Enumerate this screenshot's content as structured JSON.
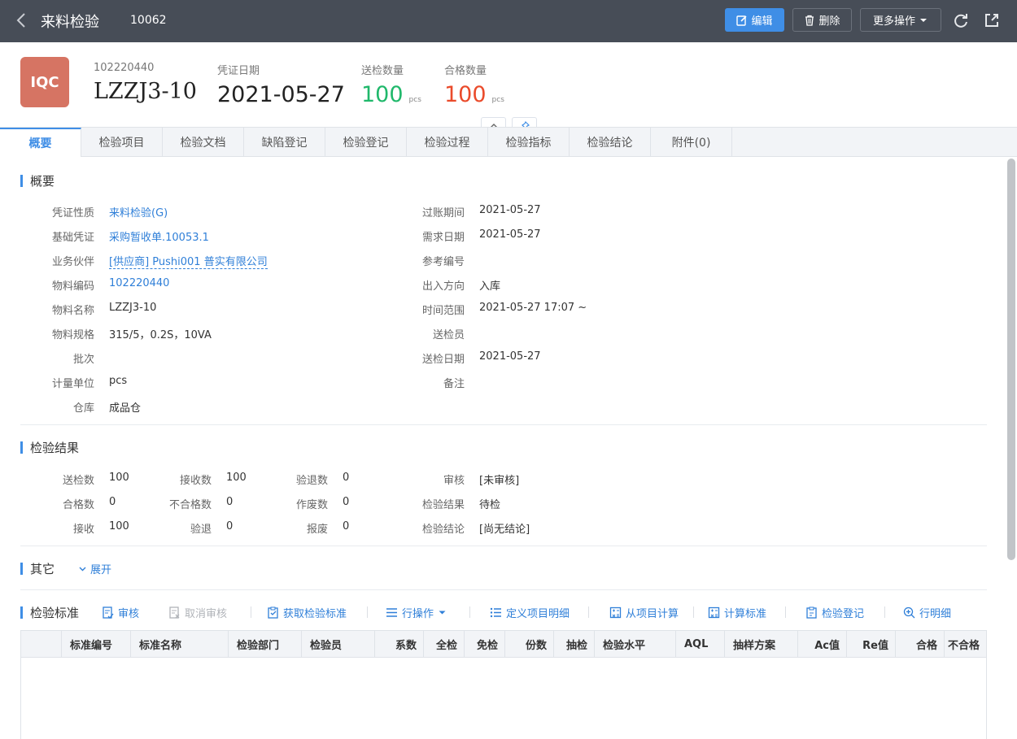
{
  "topbar": {
    "title": "来料检验",
    "doc_number": "10062",
    "edit_label": "编辑",
    "delete_label": "删除",
    "more_label": "更多操作",
    "bg_color": "#474d57",
    "accent_color": "#3f8ee6"
  },
  "header": {
    "avatar_text": "IQC",
    "avatar_color": "#d67463",
    "code_label": "102220440",
    "code_value": "LZZJ3-10",
    "date_label": "凭证日期",
    "date_value": "2021-05-27",
    "sent_qty_label": "送检数量",
    "sent_qty_value": "100",
    "sent_qty_unit": "pcs",
    "pass_qty_label": "合格数量",
    "pass_qty_value": "100",
    "pass_qty_unit": "pcs"
  },
  "tabs": [
    "概要",
    "检验项目",
    "检验文档",
    "缺陷登记",
    "检验登记",
    "检验过程",
    "检验指标",
    "检验结论",
    "附件(0)"
  ],
  "overview": {
    "title": "概要",
    "left": [
      {
        "label": "凭证性质",
        "value": "来料检验(G)"
      },
      {
        "label": "基础凭证",
        "value": "采购暂收单.10053.1"
      },
      {
        "label": "业务伙伴",
        "value": "[供应商] Pushi001 普实有限公司"
      },
      {
        "label": "物料编码",
        "value": "102220440"
      },
      {
        "label": "物料名称",
        "value": "LZZJ3-10"
      },
      {
        "label": "物料规格",
        "value": "315/5，0.2S，10VA"
      },
      {
        "label": "批次",
        "value": ""
      },
      {
        "label": "计量单位",
        "value": "pcs"
      },
      {
        "label": "仓库",
        "value": "成品仓"
      }
    ],
    "right": [
      {
        "label": "过账期间",
        "value": "2021-05-27"
      },
      {
        "label": "需求日期",
        "value": "2021-05-27"
      },
      {
        "label": "参考编号",
        "value": ""
      },
      {
        "label": "出入方向",
        "value": "入库"
      },
      {
        "label": "时间范围",
        "value": "2021-05-27 17:07 ~"
      },
      {
        "label": "送检员",
        "value": ""
      },
      {
        "label": "送检日期",
        "value": "2021-05-27"
      },
      {
        "label": "备注",
        "value": ""
      }
    ]
  },
  "result": {
    "title": "检验结果",
    "rows": [
      [
        {
          "label": "送检数",
          "value": "100"
        },
        {
          "label": "接收数",
          "value": "100"
        },
        {
          "label": "验退数",
          "value": "0"
        },
        {
          "label": "审核",
          "value": "[未审核]"
        }
      ],
      [
        {
          "label": "合格数",
          "value": "0"
        },
        {
          "label": "不合格数",
          "value": "0"
        },
        {
          "label": "作废数",
          "value": "0"
        },
        {
          "label": "检验结果",
          "value": "待检"
        }
      ],
      [
        {
          "label": "接收",
          "value": "100"
        },
        {
          "label": "验退",
          "value": "0"
        },
        {
          "label": "报废",
          "value": "0"
        },
        {
          "label": "检验结论",
          "value": "[尚无结论]"
        }
      ]
    ]
  },
  "other": {
    "title": "其它",
    "expand_label": "展开"
  },
  "standard": {
    "title": "检验标准",
    "toolbar": {
      "audit": "审核",
      "cancel_audit": "取消审核",
      "get_standard": "获取检验标准",
      "row_ops": "行操作",
      "define_detail": "定义项目明细",
      "calc_from_item": "从项目计算",
      "calc_standard": "计算标准",
      "inspect_register": "检验登记",
      "row_detail": "行明细"
    },
    "columns": [
      "标准编号",
      "标准名称",
      "检验部门",
      "检验员",
      "系数",
      "全检",
      "免检",
      "份数",
      "抽检",
      "检验水平",
      "AQL",
      "抽样方案",
      "Ac值",
      "Re值",
      "合格",
      "不合格"
    ]
  }
}
